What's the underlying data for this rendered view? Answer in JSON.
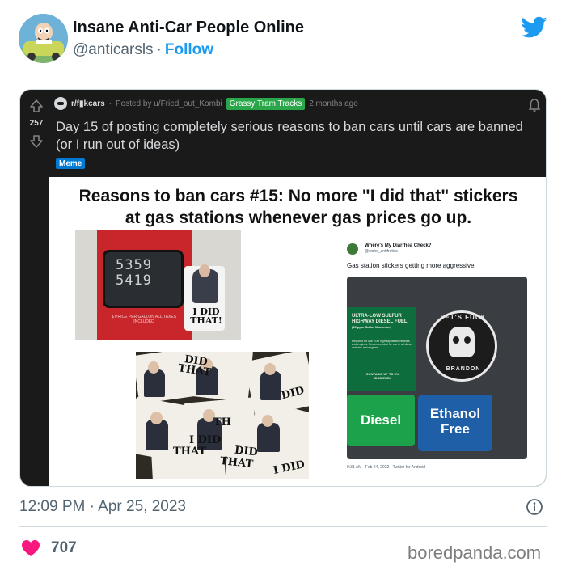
{
  "account": {
    "name": "Insane Anti-Car People Online",
    "handle": "@anticarsls",
    "separator": "·",
    "follow_label": "Follow"
  },
  "reddit_post": {
    "score": "257",
    "subreddit": "r/f▮kcars",
    "posted_by": "Posted by u/Fried_out_Kombi",
    "user_flair": "Grassy Tram Tracks",
    "age": "2 months ago",
    "title": "Day 15 of posting completely serious reasons to ban cars until cars are banned (or I run out of ideas)",
    "post_flair": "Meme"
  },
  "meme": {
    "caption_line1": "Reasons to ban cars #15: No more \"I did that\" stickers",
    "caption_line2": "at gas stations whenever gas prices go up.",
    "pump_price_line1": "5359",
    "pump_price_line2": "5419",
    "pump_small_text": "$ PRICE PER GALLON ALL TAXES INCLUDED",
    "sticker_text": "I DID THAT!",
    "collage_texts": [
      "DID",
      "THAT",
      "TH",
      "I DID",
      "THAT",
      "DID",
      "THAT",
      "DID",
      "I DID"
    ]
  },
  "embedded_tweet": {
    "name": "Where's My Diarrhea Check?",
    "handle": "@woke_antifrotics",
    "more": "···",
    "text": "Gas station stickers getting more aggressive",
    "pump_label": "ULTRA-LOW SULFUR HIGHWAY DIESEL FUEL",
    "pump_label_sub": "(15 ppm Sulfur Maximum)",
    "pump_label_small": "Required for use in all highway diesel vehicles and engines. Recommended for use in all diesel vehicles and engines.",
    "pump_contains": "CONTAINS UP TO 5% BIODIESEL",
    "skull_top": "LET'S FUCK",
    "skull_bottom": "BRANDON",
    "diesel_button": "Diesel",
    "ethanol_button_line1": "Ethanol",
    "ethanol_button_line2": "Free",
    "footer": "9:31 AM · Feb 24, 2022 · Twitter for Android"
  },
  "footer": {
    "timestamp": "12:09 PM · Apr 25, 2023",
    "likes": "707",
    "watermark": "boredpanda.com"
  },
  "colors": {
    "twitter_blue": "#1d9bf0",
    "heart_red": "#f91880",
    "reddit_dark": "#1a1a1b",
    "flair_green": "#2aa74a",
    "meme_flair_blue": "#0079d3"
  },
  "icons": [
    "family-guy-avatar",
    "twitter-bird-icon",
    "upvote-arrow-icon",
    "downvote-arrow-icon",
    "notification-bell-icon",
    "info-icon",
    "heart-icon"
  ]
}
